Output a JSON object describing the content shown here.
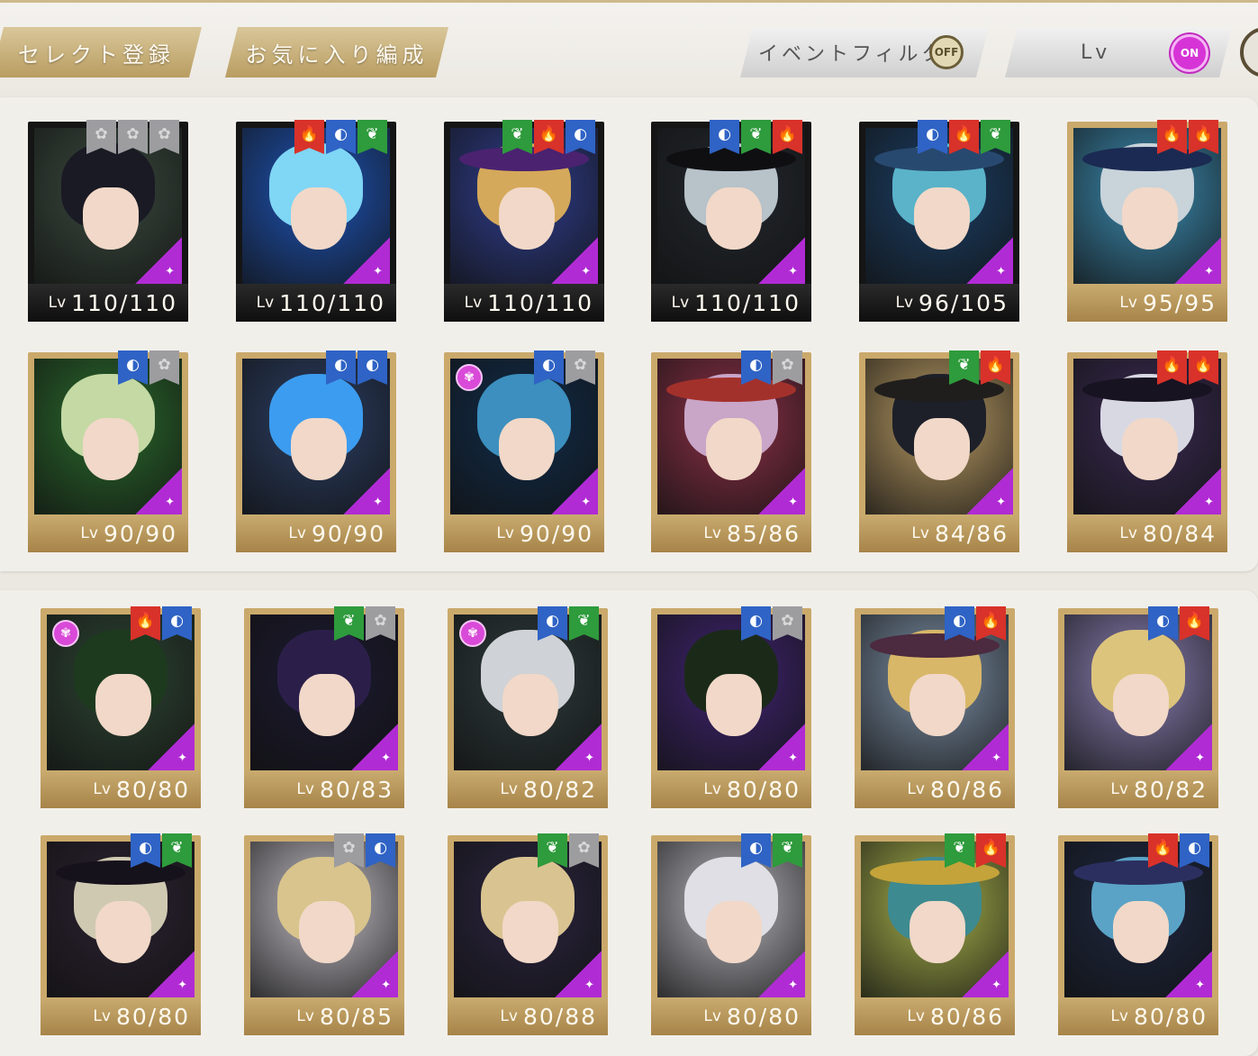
{
  "toolbar": {
    "select_register": "セレクト登録",
    "favorite_formation": "お気に入り編成",
    "event_filter": "イベントフィルタ",
    "event_filter_state": "OFF",
    "sort_label": "Lv",
    "sort_state": "ON"
  },
  "lv_prefix": "Lv",
  "colors": {
    "fire": "#d8322a",
    "water": "#2f63c5",
    "wood": "#2e9b3c",
    "flora": "#9d9da0",
    "gold": "#caa96b"
  },
  "cards": [
    {
      "level": "110/110",
      "attrs": [
        "flora",
        "flora",
        "flora"
      ],
      "frame": "dark",
      "hair": "#1a1a24",
      "bg": "#3a4a3e",
      "hat": "",
      "sparkle": false
    },
    {
      "level": "110/110",
      "attrs": [
        "fire",
        "water",
        "wood"
      ],
      "frame": "dark",
      "hair": "#7fd6f5",
      "bg": "#1e54b7",
      "hat": "",
      "sparkle": false
    },
    {
      "level": "110/110",
      "attrs": [
        "wood",
        "fire",
        "water"
      ],
      "frame": "dark",
      "hair": "#d5a95b",
      "bg": "#2f3e8e",
      "hat": "#4a2270",
      "sparkle": false
    },
    {
      "level": "110/110",
      "attrs": [
        "water",
        "wood",
        "fire"
      ],
      "frame": "dark",
      "hair": "#b7c2c9",
      "bg": "#23282e",
      "hat": "#0f0f12",
      "sparkle": false
    },
    {
      "level": "96/105",
      "attrs": [
        "water",
        "fire",
        "wood"
      ],
      "frame": "dark",
      "hair": "#5ab3c9",
      "bg": "#1b3f66",
      "hat": "#28496f",
      "sparkle": false
    },
    {
      "level": "95/95",
      "attrs": [
        "fire",
        "fire"
      ],
      "frame": "gold",
      "hair": "#c8d3da",
      "bg": "#3c8db3",
      "hat": "#1b2a52",
      "sparkle": false
    },
    {
      "level": "90/90",
      "attrs": [
        "water",
        "flora"
      ],
      "frame": "gold",
      "hair": "#c4d9a4",
      "bg": "#2a6a2c",
      "hat": "",
      "sparkle": false
    },
    {
      "level": "90/90",
      "attrs": [
        "water",
        "water"
      ],
      "frame": "gold",
      "hair": "#3c9cf0",
      "bg": "#2b3e63",
      "hat": "",
      "sparkle": false
    },
    {
      "level": "90/90",
      "attrs": [
        "water",
        "flora"
      ],
      "frame": "gold",
      "hair": "#3c8fbe",
      "bg": "#112c4a",
      "hat": "",
      "sparkle": true
    },
    {
      "level": "85/86",
      "attrs": [
        "water",
        "flora"
      ],
      "frame": "gold",
      "hair": "#c9a5c8",
      "bg": "#8c3047",
      "hat": "#a3312b",
      "sparkle": false
    },
    {
      "level": "84/86",
      "attrs": [
        "wood",
        "fire"
      ],
      "frame": "gold",
      "hair": "#1d2029",
      "bg": "#b89a63",
      "hat": "#201e1c",
      "sparkle": false
    },
    {
      "level": "80/84",
      "attrs": [
        "fire",
        "fire"
      ],
      "frame": "gold",
      "hair": "#d8d8e3",
      "bg": "#3a2a52",
      "hat": "#171321",
      "sparkle": false
    },
    {
      "level": "80/80",
      "attrs": [
        "fire",
        "water"
      ],
      "frame": "gold",
      "hair": "#1d3a1f",
      "bg": "#2d4433",
      "hat": "",
      "sparkle": true
    },
    {
      "level": "80/83",
      "attrs": [
        "wood",
        "flora"
      ],
      "frame": "gold",
      "hair": "#2b1f4a",
      "bg": "#1c1a30",
      "hat": "",
      "sparkle": false
    },
    {
      "level": "80/82",
      "attrs": [
        "water",
        "wood"
      ],
      "frame": "gold",
      "hair": "#cfd2d6",
      "bg": "#2d3a3b",
      "hat": "",
      "sparkle": true
    },
    {
      "level": "80/80",
      "attrs": [
        "water",
        "flora"
      ],
      "frame": "gold",
      "hair": "#1b2a18",
      "bg": "#3f2470",
      "hat": "",
      "sparkle": false
    },
    {
      "level": "80/86",
      "attrs": [
        "water",
        "fire"
      ],
      "frame": "gold",
      "hair": "#d8b769",
      "bg": "#7c8fa5",
      "hat": "#4c2a3f",
      "sparkle": false
    },
    {
      "level": "80/82",
      "attrs": [
        "water",
        "fire"
      ],
      "frame": "gold",
      "hair": "#dcc47c",
      "bg": "#8a7fb2",
      "hat": "",
      "sparkle": false
    },
    {
      "level": "80/80",
      "attrs": [
        "water",
        "wood"
      ],
      "frame": "gold",
      "hair": "#cfc9b2",
      "bg": "#2b2231",
      "hat": "#16121c",
      "sparkle": false
    },
    {
      "level": "80/85",
      "attrs": [
        "flora",
        "water"
      ],
      "frame": "gold",
      "hair": "#d8c48c",
      "bg": "#c4c0c7",
      "hat": "",
      "sparkle": false
    },
    {
      "level": "80/88",
      "attrs": [
        "wood",
        "flora"
      ],
      "frame": "gold",
      "hair": "#d9c491",
      "bg": "#2b2540",
      "hat": "",
      "sparkle": false
    },
    {
      "level": "80/80",
      "attrs": [
        "water",
        "wood"
      ],
      "frame": "gold",
      "hair": "#dfdfe5",
      "bg": "#b7b6bd",
      "hat": "",
      "sparkle": false
    },
    {
      "level": "80/86",
      "attrs": [
        "wood",
        "fire"
      ],
      "frame": "gold",
      "hair": "#3d8a90",
      "bg": "#a9b34c",
      "hat": "#c4a33a",
      "sparkle": false
    },
    {
      "level": "80/80",
      "attrs": [
        "fire",
        "water"
      ],
      "frame": "gold",
      "hair": "#5aa3c6",
      "bg": "#1f2842",
      "hat": "#2b2f5f",
      "sparkle": false
    }
  ]
}
